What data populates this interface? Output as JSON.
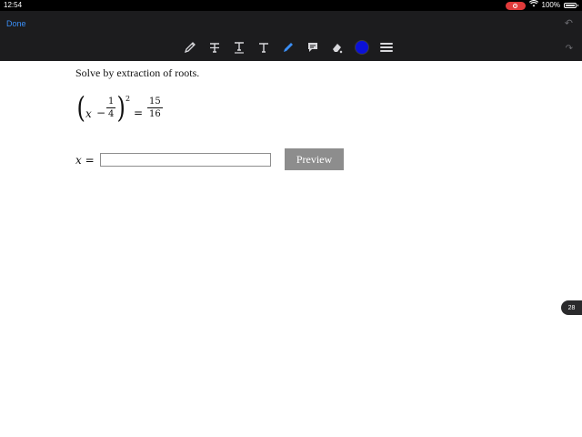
{
  "status": {
    "time": "12:54",
    "battery": "100%"
  },
  "toolbar": {
    "done_label": "Done",
    "undo_glyph": "↶",
    "redo_glyph": "↷",
    "accent_color": "#3a8ef6",
    "pen_color": "#0b11d8",
    "tools": [
      "pencil-icon",
      "strikethrough-text-icon",
      "underline-text-icon",
      "text-icon",
      "highlighter-icon",
      "comment-icon",
      "eraser-icon",
      "color-picker",
      "line-weight-icon"
    ]
  },
  "problem": {
    "prompt": "Solve by extraction of roots.",
    "var": "x",
    "minus": "−",
    "frac_left": {
      "num": "1",
      "den": "4"
    },
    "exponent": "2",
    "equals": "=",
    "frac_right": {
      "num": "15",
      "den": "16"
    }
  },
  "answer": {
    "label_var": "x",
    "label_eq": "=",
    "value": "",
    "placeholder": ""
  },
  "preview_label": "Preview",
  "page_number": "28"
}
